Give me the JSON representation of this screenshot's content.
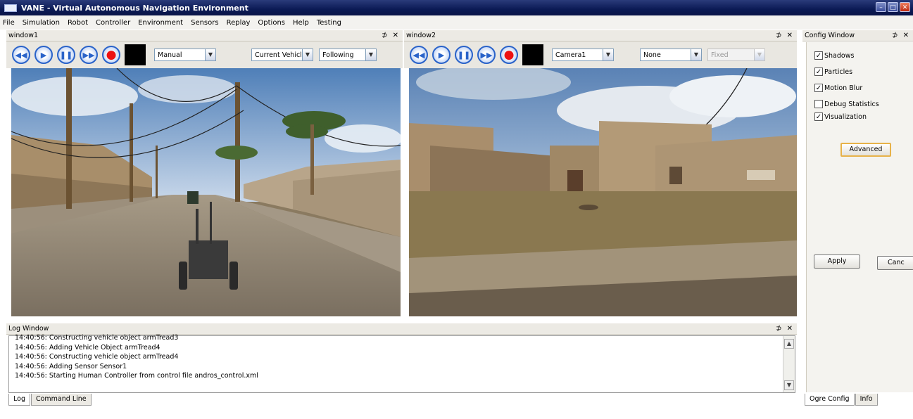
{
  "window": {
    "title": "VANE - Virtual Autonomous Navigation Environment"
  },
  "menu": [
    "File",
    "Simulation",
    "Robot",
    "Controller",
    "Environment",
    "Sensors",
    "Replay",
    "Options",
    "Help",
    "Testing"
  ],
  "window1": {
    "title": "window1",
    "mode": "Manual",
    "vehicle": "Current Vehicl",
    "follow": "Following"
  },
  "window2": {
    "title": "window2",
    "camera": "Camera1",
    "target": "None",
    "fixed": "Fixed"
  },
  "panel_controls": "⊅ ✕",
  "config": {
    "title": "Config Window",
    "checkboxes": [
      {
        "label": "Shadows",
        "checked": true
      },
      {
        "label": "Particles",
        "checked": true
      },
      {
        "label": "Motion Blur",
        "checked": true
      },
      {
        "label": "Debug Statistics",
        "checked": false
      },
      {
        "label": "Visualization",
        "checked": true
      }
    ],
    "advanced": "Advanced",
    "apply": "Apply",
    "cancel": "Canc",
    "tabs": [
      "Ogre Config",
      "Info"
    ]
  },
  "log": {
    "title": "Log Window",
    "lines": [
      "14:40:56: Constructing vehicle object armTread3",
      "14:40:56: Adding Vehicle Object armTread4",
      "14:40:56: Constructing vehicle object armTread4",
      "14:40:56: Adding Sensor Sensor1",
      "14:40:56: Starting Human Controller from control file andros_control.xml"
    ],
    "tabs": [
      "Log",
      "Command Line"
    ]
  }
}
